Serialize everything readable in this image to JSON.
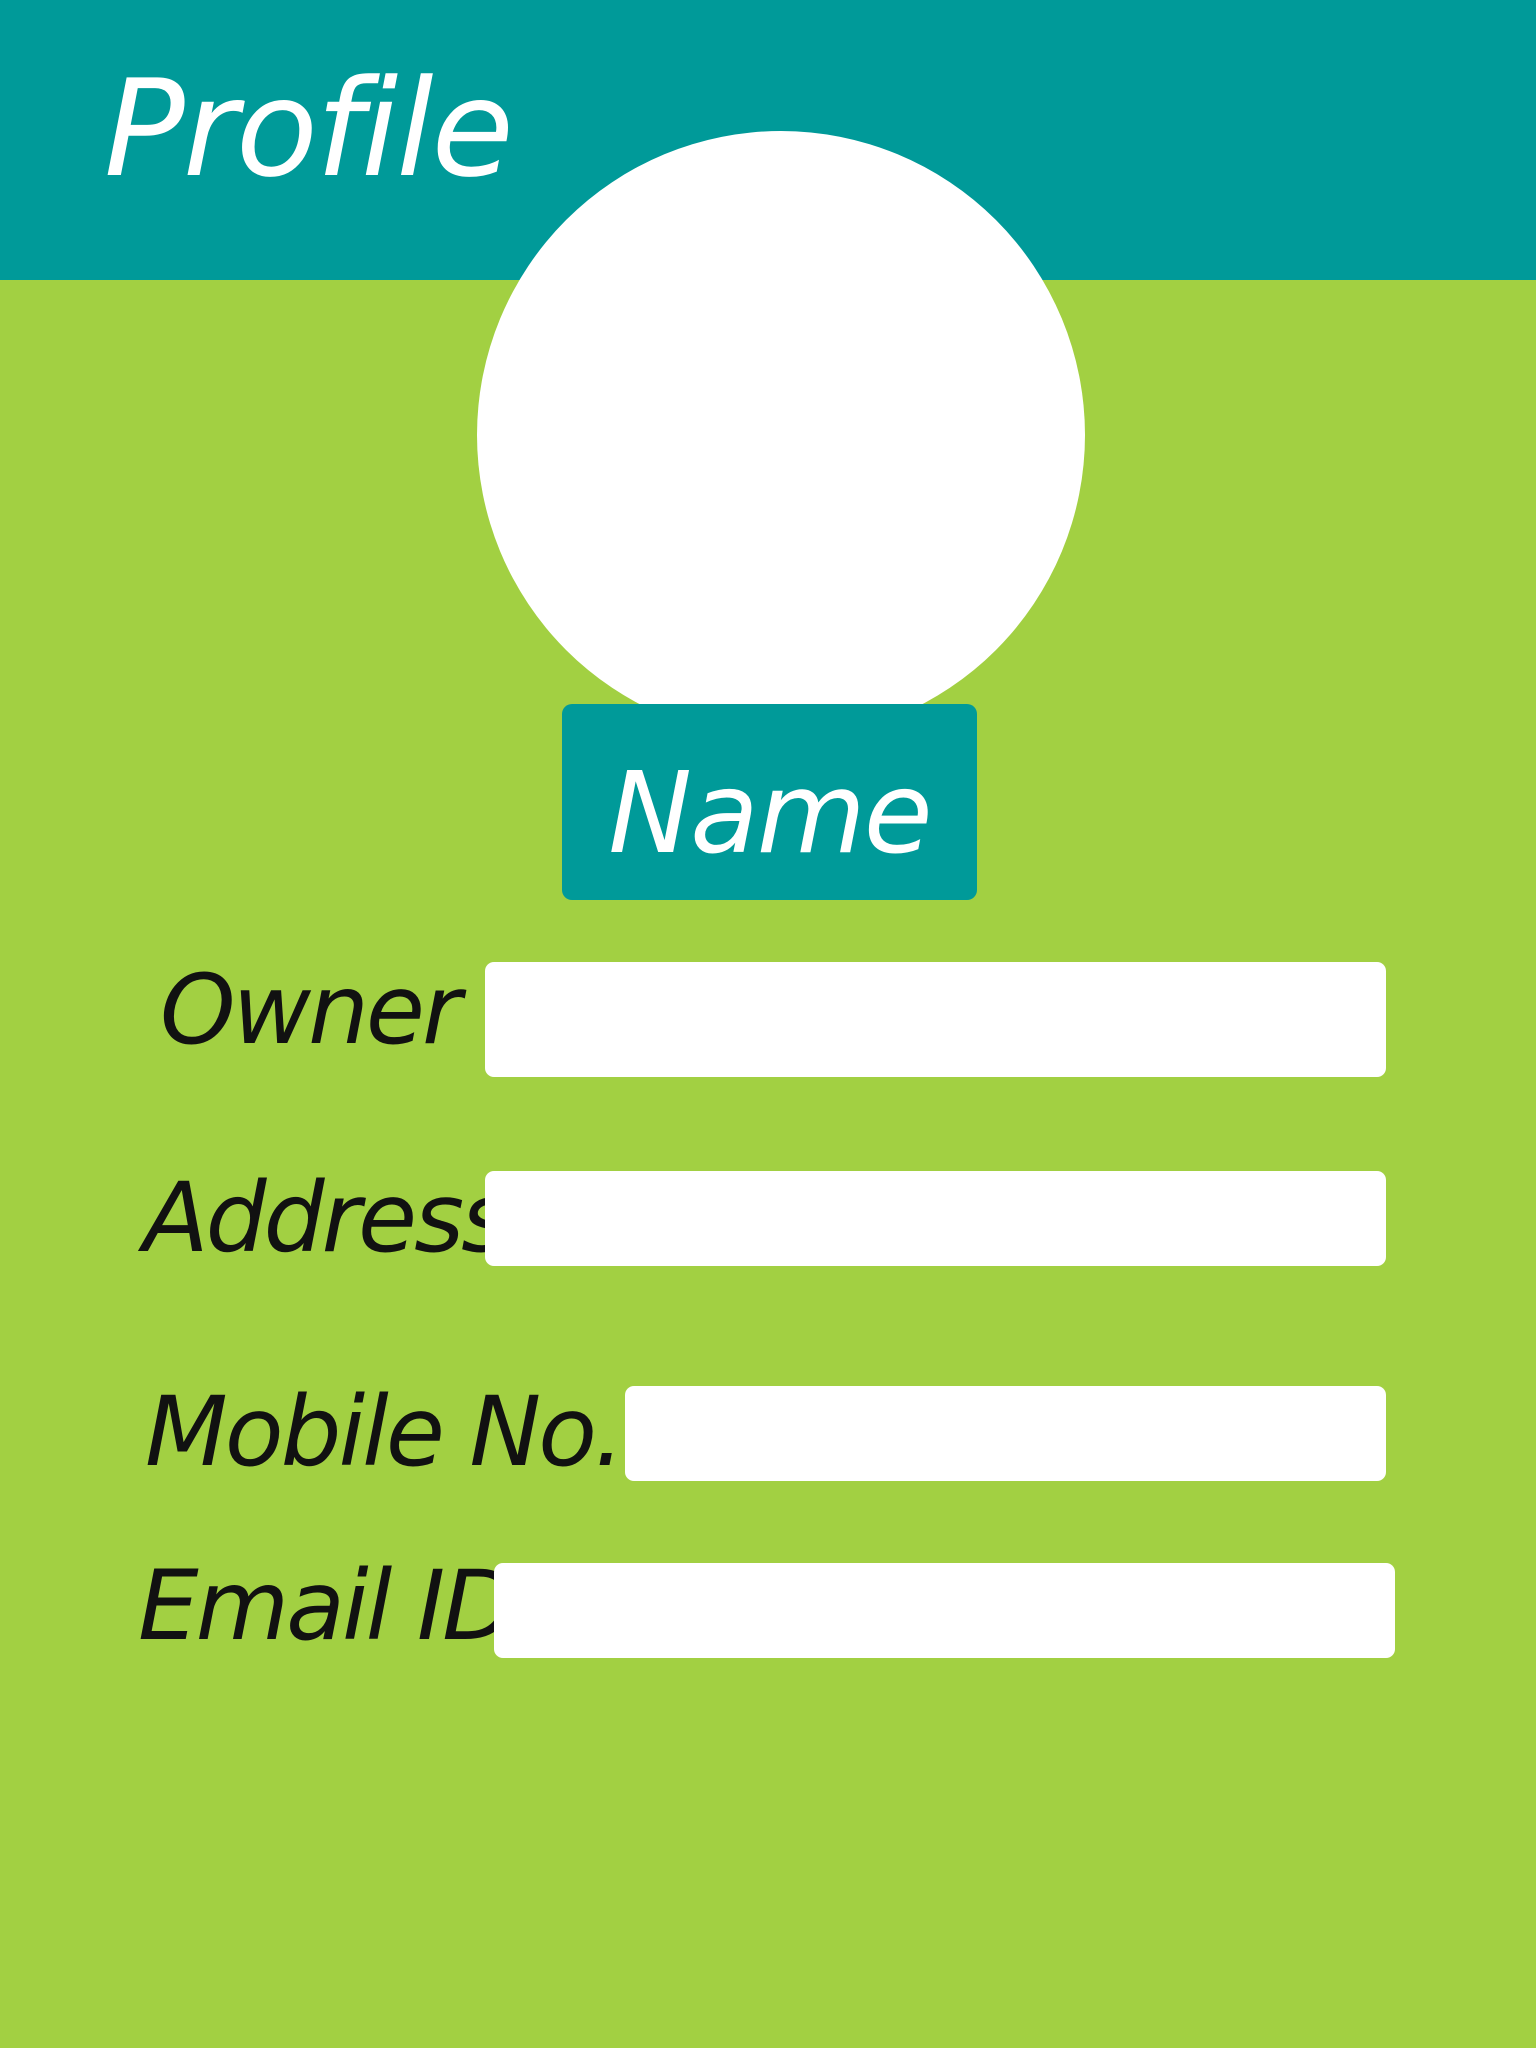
{
  "header": {
    "title": "Profile"
  },
  "profile": {
    "name_label": "Name"
  },
  "fields": {
    "owner": {
      "label": "Owner",
      "value": ""
    },
    "address": {
      "label": "Address",
      "value": ""
    },
    "mobile": {
      "label": "Mobile No.",
      "value": ""
    },
    "email": {
      "label": "Email ID",
      "value": ""
    }
  },
  "colors": {
    "header_background": "#009a99",
    "page_background": "#a2d042",
    "card_white": "#ffffff",
    "label_text": "#111111"
  }
}
